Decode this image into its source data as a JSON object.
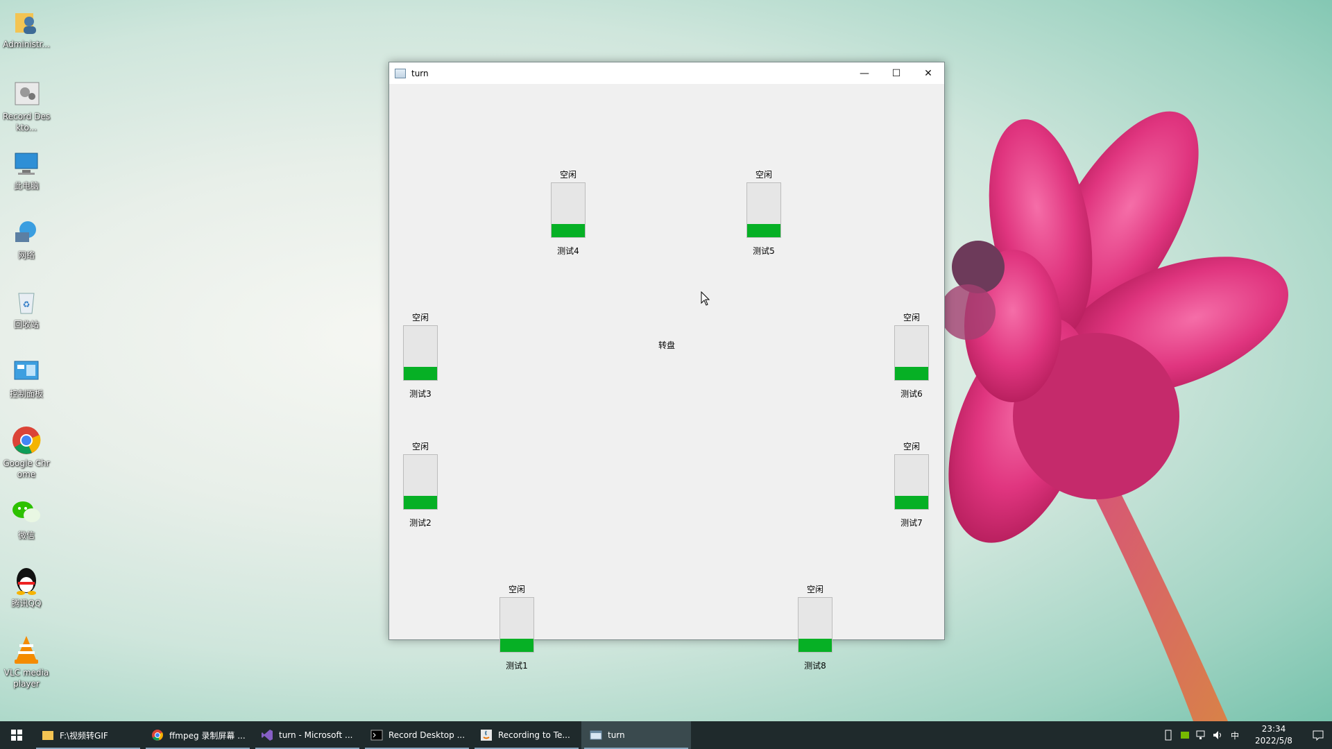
{
  "desktop": {
    "icons": [
      {
        "label": "Administr...",
        "icon": "user-folder-icon"
      },
      {
        "label": "Record Deskto...",
        "icon": "record-desktop-icon"
      },
      {
        "label": "此电脑",
        "icon": "computer-icon"
      },
      {
        "label": "网络",
        "icon": "network-icon"
      },
      {
        "label": "回收站",
        "icon": "recycle-bin-icon"
      },
      {
        "label": "控制面板",
        "icon": "control-panel-icon"
      },
      {
        "label": "Google Chrome",
        "icon": "chrome-icon"
      },
      {
        "label": "微信",
        "icon": "wechat-icon"
      },
      {
        "label": "腾讯QQ",
        "icon": "qq-icon"
      },
      {
        "label": "VLC media player",
        "icon": "vlc-icon"
      }
    ]
  },
  "window": {
    "title": "turn",
    "controls": {
      "minimize": "—",
      "maximize": "☐",
      "close": "✕"
    },
    "center_label": "转盘",
    "slots": [
      {
        "status": "空闲",
        "name": "测试4",
        "fill_percent": 25
      },
      {
        "status": "空闲",
        "name": "测试5",
        "fill_percent": 25
      },
      {
        "status": "空闲",
        "name": "测试3",
        "fill_percent": 25
      },
      {
        "status": "空闲",
        "name": "测试6",
        "fill_percent": 25
      },
      {
        "status": "空闲",
        "name": "测试2",
        "fill_percent": 25
      },
      {
        "status": "空闲",
        "name": "测试7",
        "fill_percent": 25
      },
      {
        "status": "空闲",
        "name": "测试1",
        "fill_percent": 25
      },
      {
        "status": "空闲",
        "name": "测试8",
        "fill_percent": 25
      }
    ],
    "bar_color": "#06b025"
  },
  "taskbar": {
    "items": [
      {
        "label": "F:\\视频转GIF",
        "icon": "folder-icon"
      },
      {
        "label": "ffmpeg 录制屏幕 ...",
        "icon": "chrome-icon"
      },
      {
        "label": "turn - Microsoft ...",
        "icon": "visual-studio-icon"
      },
      {
        "label": "Record Desktop ...",
        "icon": "console-icon"
      },
      {
        "label": "Recording to Te...",
        "icon": "java-icon"
      },
      {
        "label": "turn",
        "icon": "window-app-icon"
      }
    ],
    "tray": {
      "ime": "中",
      "time": "23:34",
      "date": "2022/5/8"
    }
  }
}
